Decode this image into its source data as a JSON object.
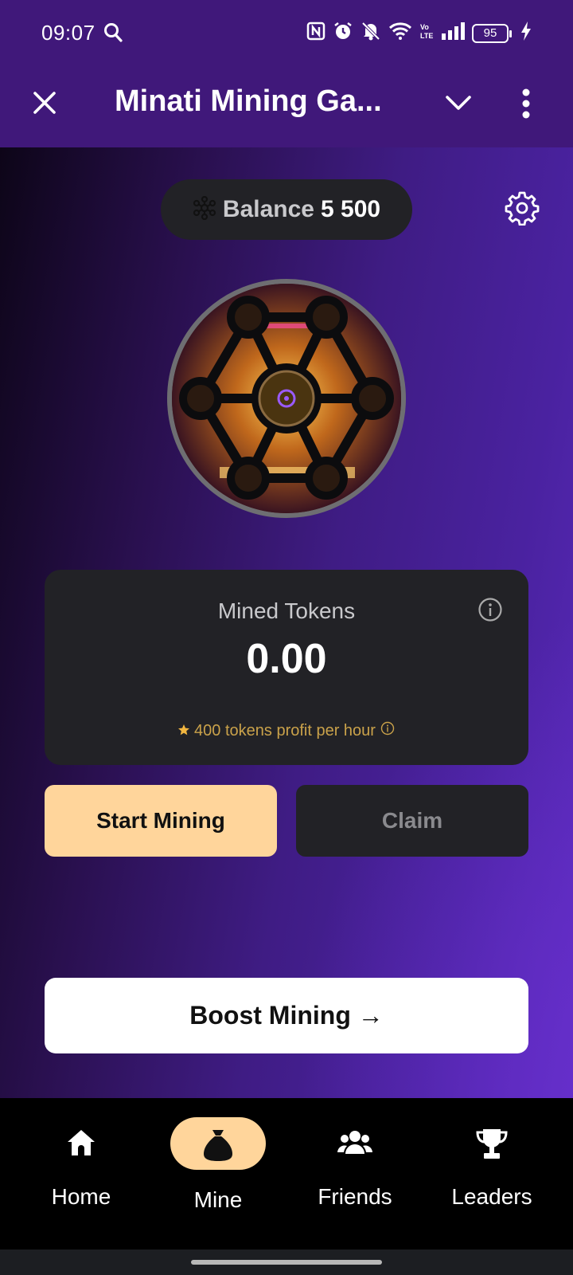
{
  "status_bar": {
    "time": "09:07",
    "battery": "95"
  },
  "header": {
    "title": "Minati Mining Ga..."
  },
  "balance": {
    "label": "Balance",
    "value": "5 500"
  },
  "mined": {
    "label": "Mined Tokens",
    "value": "0.00",
    "profit_text": "400 tokens profit per hour"
  },
  "actions": {
    "start_label": "Start Mining",
    "claim_label": "Claim",
    "boost_label": "Boost Mining →"
  },
  "nav": {
    "items": [
      {
        "label": "Home",
        "icon": "home-icon"
      },
      {
        "label": "Mine",
        "icon": "money-bag-icon",
        "active": true
      },
      {
        "label": "Friends",
        "icon": "friends-icon"
      },
      {
        "label": "Leaders",
        "icon": "trophy-icon"
      }
    ]
  },
  "colors": {
    "header_bg": "#40187a",
    "accent": "#ffd59b",
    "card_bg": "#222226",
    "profit_text": "#caa24a"
  }
}
